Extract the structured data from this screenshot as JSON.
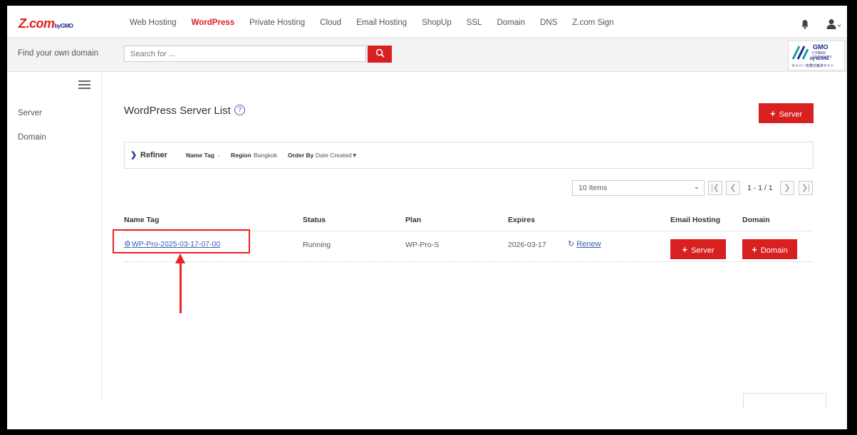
{
  "logo": {
    "main": "Z.com",
    "by": "by",
    "gmo": "GMO"
  },
  "nav": [
    {
      "label": "Web Hosting",
      "active": false
    },
    {
      "label": "WordPress",
      "active": true
    },
    {
      "label": "Private Hosting",
      "active": false
    },
    {
      "label": "Cloud",
      "active": false
    },
    {
      "label": "Email Hosting",
      "active": false
    },
    {
      "label": "ShopUp",
      "active": false
    },
    {
      "label": "SSL",
      "active": false
    },
    {
      "label": "Domain",
      "active": false
    },
    {
      "label": "DNS",
      "active": false
    },
    {
      "label": "Z.com Sign",
      "active": false
    }
  ],
  "search": {
    "find_label": "Find your own domain",
    "placeholder": "Search for ..."
  },
  "badge": {
    "gmo": "GMO",
    "line1": "CYBER SECURITY",
    "line2": "by IERAE",
    "line3": "サイバー攻撃対策済サイト"
  },
  "sidebar": {
    "items": [
      {
        "label": "Server"
      },
      {
        "label": "Domain"
      }
    ]
  },
  "main": {
    "title": "WordPress Server List",
    "help": "?",
    "add_server_label": "Server",
    "refiner": {
      "title": "Refiner",
      "name_tag_label": "Name Tag",
      "name_tag_value": "-",
      "region_label": "Region",
      "region_value": "Bangkok",
      "order_label": "Order By",
      "order_value": "Date Created▼"
    },
    "pagination": {
      "items_per_page": "10 Items",
      "page_info": "1 - 1 / 1"
    },
    "table": {
      "headers": {
        "name_tag": "Name Tag",
        "status": "Status",
        "plan": "Plan",
        "expires": "Expires",
        "email": "Email Hosting",
        "domain": "Domain"
      },
      "rows": [
        {
          "name_tag": "WP-Pro-2025-03-17-07-00",
          "status": "Running",
          "plan": "WP-Pro-S",
          "expires": "2026-03-17",
          "renew": "Renew",
          "email_button": "Server",
          "domain_button": "Domain"
        }
      ]
    }
  },
  "colors": {
    "accent": "#d82020",
    "link": "#3a5fb0",
    "annotation": "#ee2222"
  },
  "icons": [
    "bell-icon",
    "user-icon",
    "search-icon",
    "hamburger-icon",
    "help-icon",
    "gear-icon",
    "renew-icon",
    "chevron-right-icon",
    "first-page-icon",
    "prev-page-icon",
    "next-page-icon",
    "last-page-icon"
  ]
}
